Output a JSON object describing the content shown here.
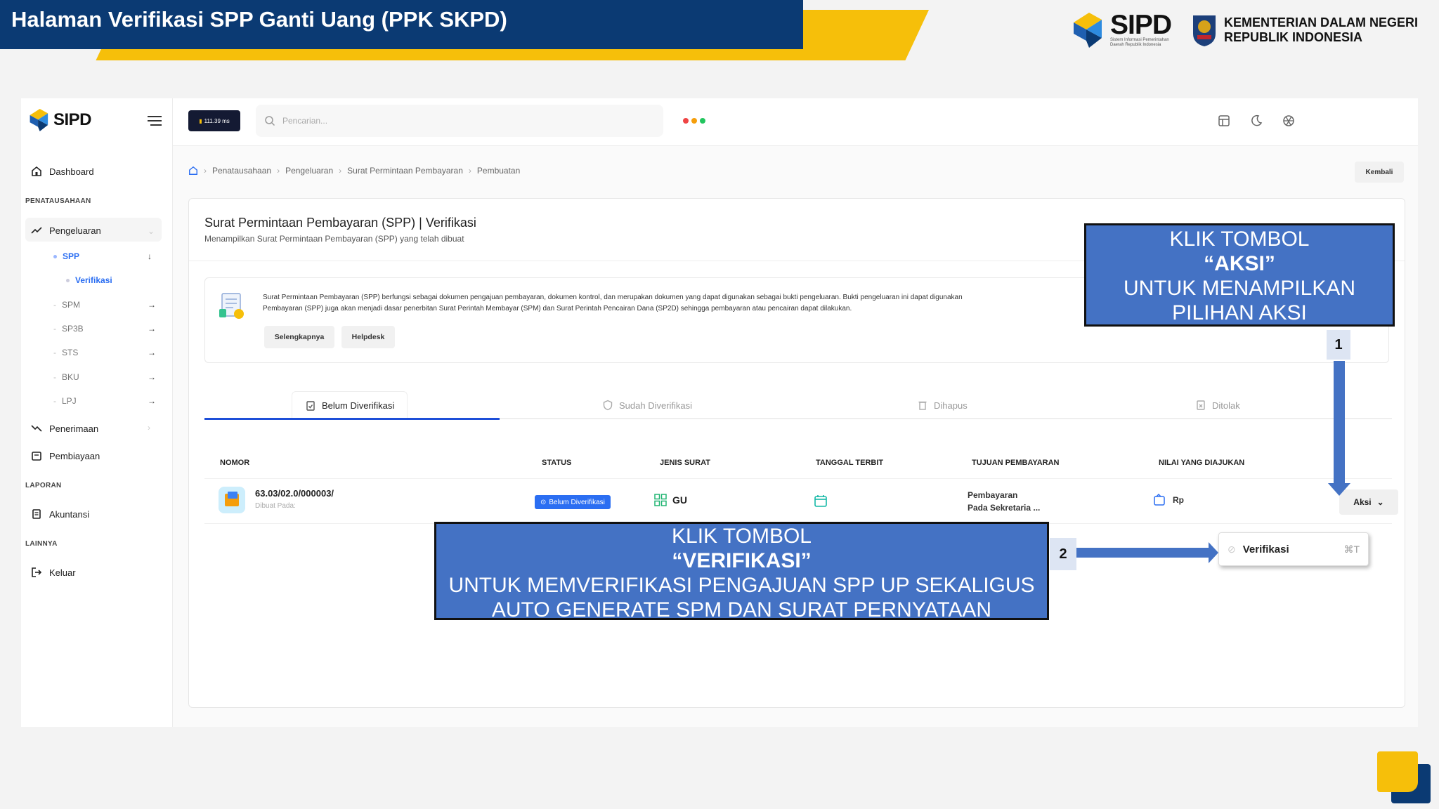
{
  "slide": {
    "title": "Halaman Verifikasi SPP Ganti Uang (PPK SKPD)",
    "brand_name": "SIPD",
    "brand_tagline": "Sistem Informasi Pemerintahan Daerah Republik Indonesia",
    "ministry_line1": "KEMENTERIAN DALAM NEGERI",
    "ministry_line2": "REPUBLIK INDONESIA"
  },
  "sidebar": {
    "logo": "SIPD",
    "dashboard": "Dashboard",
    "section_penatausahaan": "PENATAUSAHAAN",
    "pengeluaran": "Pengeluaran",
    "spp": "SPP",
    "verifikasi": "Verifikasi",
    "spm": "SPM",
    "sp3b": "SP3B",
    "sts": "STS",
    "bku": "BKU",
    "lpj": "LPJ",
    "penerimaan": "Penerimaan",
    "pembiayaan": "Pembiayaan",
    "section_laporan": "LAPORAN",
    "akuntansi": "Akuntansi",
    "section_lainnya": "LAINNYA",
    "keluar": "Keluar"
  },
  "topbar": {
    "ping": "111.39 ms",
    "search_placeholder": "Pencarian..."
  },
  "breadcrumb": {
    "items": [
      "Penatausahaan",
      "Pengeluaran",
      "Surat Permintaan Pembayaran",
      "Pembuatan"
    ],
    "back": "Kembali"
  },
  "page": {
    "title": "Surat Permintaan Pembayaran (SPP) | Verifikasi",
    "subtitle": "Menampilkan Surat Permintaan Pembayaran (SPP) yang telah dibuat",
    "info_line1": "Surat Permintaan Pembayaran (SPP) berfungsi sebagai dokumen pengajuan pembayaran, dokumen kontrol, dan merupakan dokumen yang dapat digunakan sebagai bukti pengeluaran. Bukti pengeluaran ini dapat digunakan",
    "info_line2": "Pembayaran (SPP) juga akan menjadi dasar penerbitan Surat Perintah Membayar (SPM) dan Surat Perintah Pencairan Dana (SP2D) sehingga pembayaran atau pencairan dapat dilakukan.",
    "btn_more": "Selengkapnya",
    "btn_help": "Helpdesk"
  },
  "tabs": [
    "Belum Diverifikasi",
    "Sudah Diverifikasi",
    "Dihapus",
    "Ditolak"
  ],
  "table": {
    "headers": [
      "NOMOR",
      "STATUS",
      "JENIS SURAT",
      "TANGGAL TERBIT",
      "TUJUAN PEMBAYARAN",
      "NILAI YANG DIAJUKAN"
    ],
    "row": {
      "nomor": "63.03/02.0/000003/",
      "dibuat": "Dibuat Pada:",
      "status": "Belum Diverifikasi",
      "jenis": "GU",
      "tujuan1": "Pembayaran",
      "tujuan2": "Pada Sekretaria ...",
      "nilai": "Rp",
      "aksi": "Aksi"
    }
  },
  "dropdown": {
    "label": "Verifikasi",
    "shortcut": "⌘T"
  },
  "annotations": {
    "c1_l1": "KLIK TOMBOL",
    "c1_l2": "“AKSI”",
    "c1_l3": "UNTUK MENAMPILKAN",
    "c1_l4": "PILIHAN AKSI",
    "c2_l1": "KLIK TOMBOL",
    "c2_l2": "“VERIFIKASI”",
    "c2_l3": "UNTUK MEMVERIFIKASI PENGAJUAN SPP UP SEKALIGUS",
    "c2_l4": "AUTO GENERATE SPM DAN SURAT PERNYATAAN",
    "n1": "1",
    "n2": "2"
  },
  "colors": {
    "navy": "#0b3a73",
    "yellow": "#f6bf0a",
    "callout": "#4472c4",
    "primary": "#2b6ef2"
  }
}
